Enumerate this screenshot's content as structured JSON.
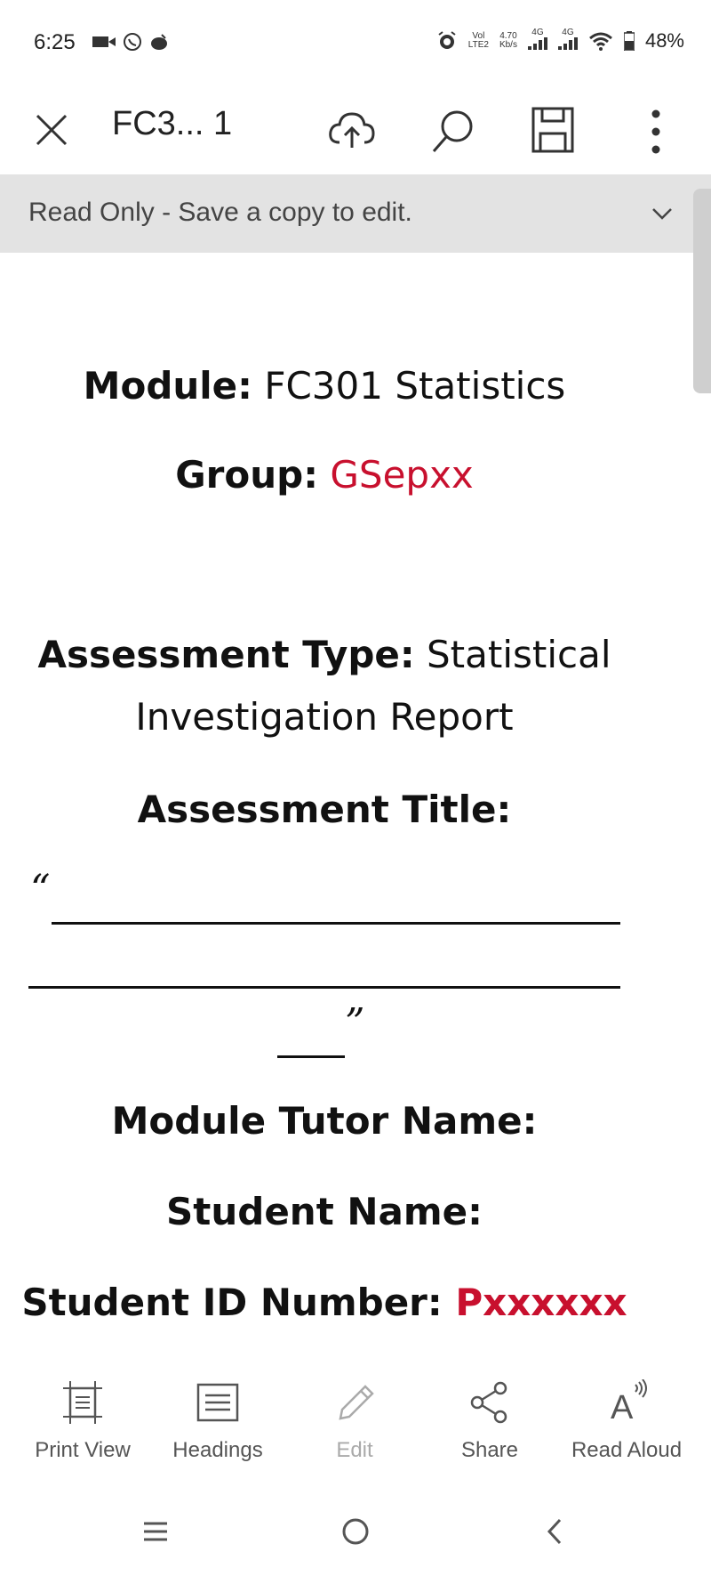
{
  "status_bar": {
    "time": "6:25",
    "net_top": "Vol",
    "net_bottom": "LTE2",
    "speed_value": "4.70",
    "speed_unit": "Kb/s",
    "signal1_label": "4G",
    "signal2_label": "4G",
    "battery": "48%"
  },
  "toolbar": {
    "title": "FC3... 1"
  },
  "banner": {
    "text": "Read Only - Save a copy to edit."
  },
  "document": {
    "module_label": "Module:",
    "module_value": " FC301 Statistics",
    "group_label": "Group:",
    "group_value": " GSepxx",
    "assessment_type_label": "Assessment Type:",
    "assessment_type_value_1": " Statistical",
    "assessment_type_value_2": "Investigation Report",
    "assessment_title_label": "Assessment Title:",
    "open_quote": "“",
    "close_quote": "”",
    "tutor_label": "Module Tutor Name:",
    "student_name_label": "Student Name:",
    "student_id_label": "Student ID Number:",
    "student_id_value": " Pxxxxxx"
  },
  "bottom_bar": {
    "items": [
      {
        "label": "Print View",
        "icon": "print-view-icon"
      },
      {
        "label": "Headings",
        "icon": "headings-icon"
      },
      {
        "label": "Edit",
        "icon": "pencil-icon"
      },
      {
        "label": "Share",
        "icon": "share-icon"
      },
      {
        "label": "Read Aloud",
        "icon": "read-aloud-icon"
      }
    ]
  },
  "colors": {
    "accent_red": "#c8102e",
    "banner_bg": "#e3e3e3"
  }
}
